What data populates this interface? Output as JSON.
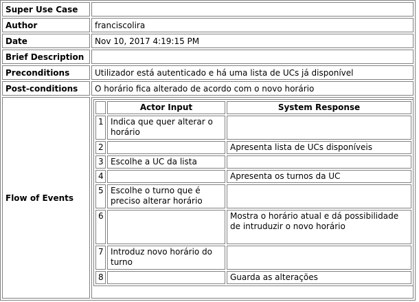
{
  "use_case": {
    "super_use_case": {
      "label": "Super Use Case",
      "value": ""
    },
    "author": {
      "label": "Author",
      "value": "franciscolira"
    },
    "date": {
      "label": "Date",
      "value": "Nov 10, 2017 4:19:15 PM"
    },
    "brief_description": {
      "label": "Brief Description",
      "value": ""
    },
    "preconditions": {
      "label": "Preconditions",
      "value": "Utilizador está autenticado e há uma lista de UCs já disponível"
    },
    "post_conditions": {
      "label": "Post-conditions",
      "value": "O horário fica alterado de acordo com o novo horário"
    },
    "flow_of_events": {
      "label": "Flow of Events"
    }
  },
  "flow_table": {
    "headers": {
      "number": "",
      "actor_input": "Actor Input",
      "system_response": "System Response"
    },
    "steps": [
      {
        "num": "1",
        "actor": "Indica que quer alterar o horário",
        "system": ""
      },
      {
        "num": "2",
        "actor": "",
        "system": "Apresenta lista de UCs disponíveis"
      },
      {
        "num": "3",
        "actor": "Escolhe a UC da lista",
        "system": ""
      },
      {
        "num": "4",
        "actor": "",
        "system": "Apresenta os turnos da UC"
      },
      {
        "num": "5",
        "actor": "Escolhe o turno que é preciso alterar horário",
        "system": ""
      },
      {
        "num": "6",
        "actor": "",
        "system": "Mostra o horário atual e dá possibilidade de intruduzir o novo horário"
      },
      {
        "num": "7",
        "actor": "Introduz novo horário do turno",
        "system": ""
      },
      {
        "num": "8",
        "actor": "",
        "system": "Guarda as alterações"
      }
    ]
  }
}
